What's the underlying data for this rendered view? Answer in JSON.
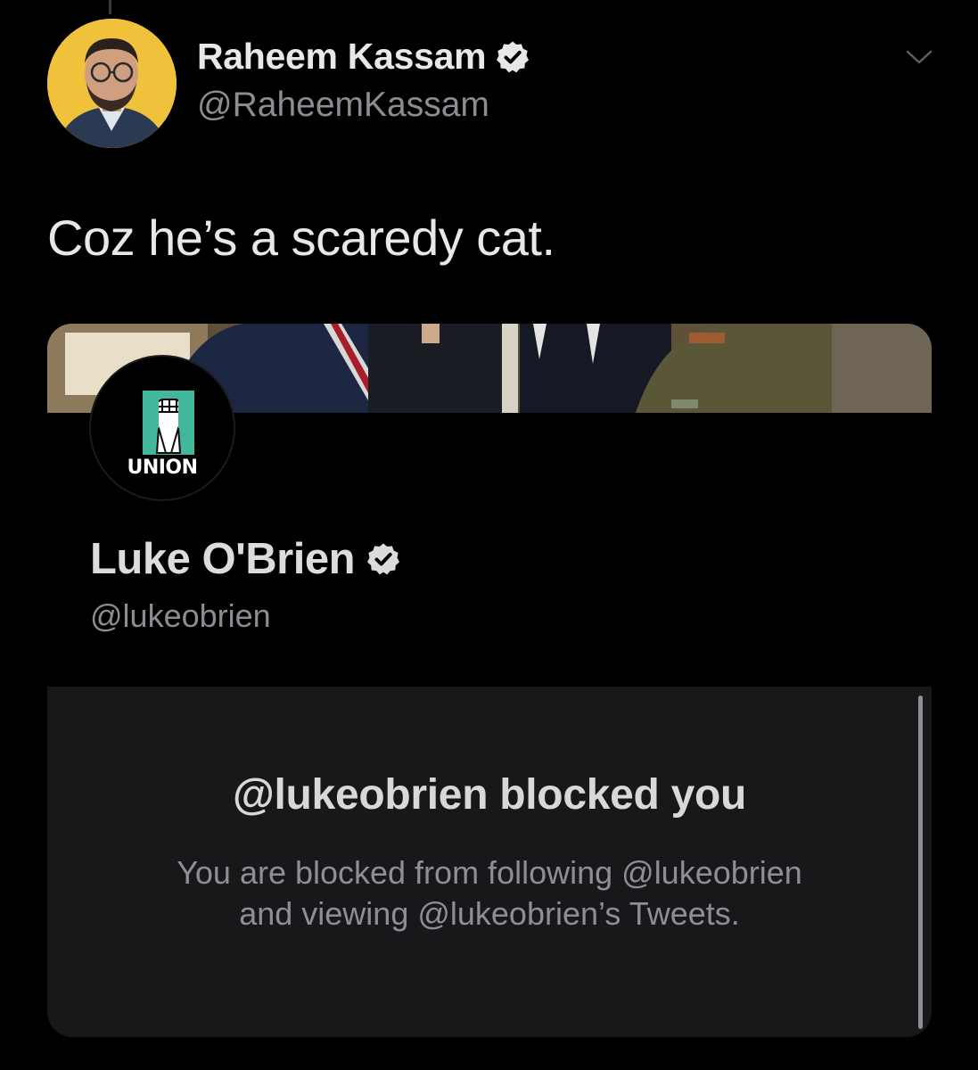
{
  "tweet": {
    "author": {
      "name": "Raheem Kassam",
      "handle": "@RaheemKassam",
      "avatar_icon": "profile-photo",
      "verified": true
    },
    "text": "Coz he’s a scaredy cat.",
    "menu_icon": "chevron-down-icon"
  },
  "embed": {
    "profile": {
      "avatar_label": "UNION",
      "avatar_icon": "raised-fist-icon",
      "name": "Luke O'Brien",
      "handle": "@lukeobrien",
      "verified": true
    },
    "blocked": {
      "title": "@lukeobrien blocked you",
      "line1": "You are blocked from following @lukeobrien",
      "line2": "and viewing @lukeobrien’s Tweets."
    }
  },
  "colors": {
    "background": "#000000",
    "panel": "#18181b",
    "text_primary": "#e8e8e8",
    "text_secondary": "#8a8d91",
    "union_green": "#43b79c",
    "avatar_yellow": "#f0c23c"
  }
}
